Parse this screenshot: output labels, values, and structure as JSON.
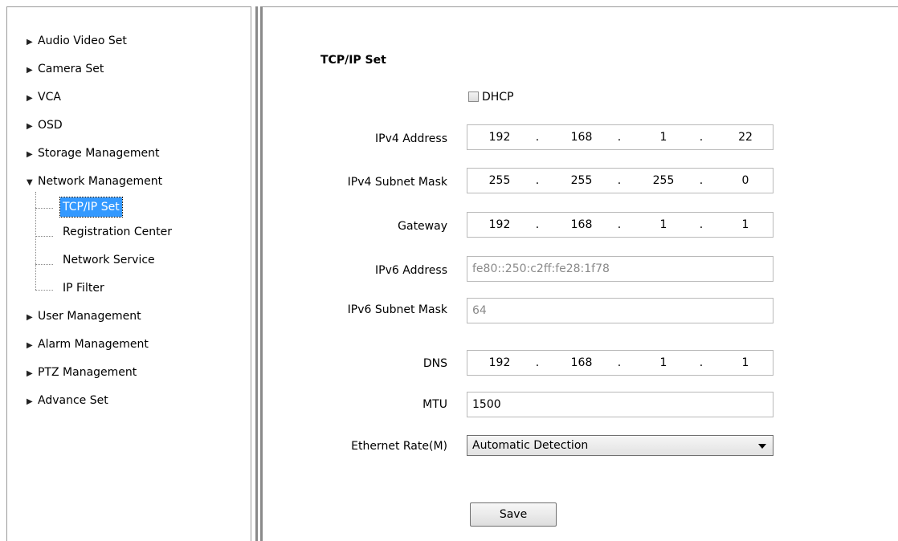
{
  "sidebar": {
    "top_items": [
      {
        "label": "Audio Video Set"
      },
      {
        "label": "Camera Set"
      },
      {
        "label": "VCA"
      },
      {
        "label": "OSD"
      },
      {
        "label": "Storage Management"
      }
    ],
    "expanded": {
      "label": "Network Management",
      "children": [
        {
          "label": "TCP/IP Set",
          "selected": true
        },
        {
          "label": "Registration Center"
        },
        {
          "label": "Network Service"
        },
        {
          "label": "IP Filter"
        }
      ]
    },
    "bottom_items": [
      {
        "label": "User Management"
      },
      {
        "label": "Alarm Management"
      },
      {
        "label": "PTZ Management"
      },
      {
        "label": "Advance Set"
      }
    ],
    "icons": {
      "collapsed": "triangle-right-icon",
      "expanded": "triangle-down-icon"
    }
  },
  "main": {
    "title": "TCP/IP Set",
    "dhcp": {
      "label": "DHCP",
      "checked": false
    },
    "ipv4_address": {
      "label": "IPv4 Address",
      "octets": [
        "192",
        "168",
        "1",
        "22"
      ]
    },
    "ipv4_subnet": {
      "label": "IPv4 Subnet Mask",
      "octets": [
        "255",
        "255",
        "255",
        "0"
      ]
    },
    "gateway": {
      "label": "Gateway",
      "octets": [
        "192",
        "168",
        "1",
        "1"
      ]
    },
    "ipv6_address": {
      "label": "IPv6 Address",
      "value": "fe80::250:c2ff:fe28:1f78"
    },
    "ipv6_subnet": {
      "label": "IPv6 Subnet Mask",
      "value": "64"
    },
    "dns": {
      "label": "DNS",
      "octets": [
        "192",
        "168",
        "1",
        "1"
      ]
    },
    "mtu": {
      "label": "MTU",
      "value": "1500"
    },
    "ethernet_rate": {
      "label": "Ethernet Rate(M)",
      "value": "Automatic Detection"
    },
    "save_label": "Save",
    "dot": "."
  },
  "colors": {
    "selection": "#3399ff",
    "border": "#9a9a9a"
  }
}
